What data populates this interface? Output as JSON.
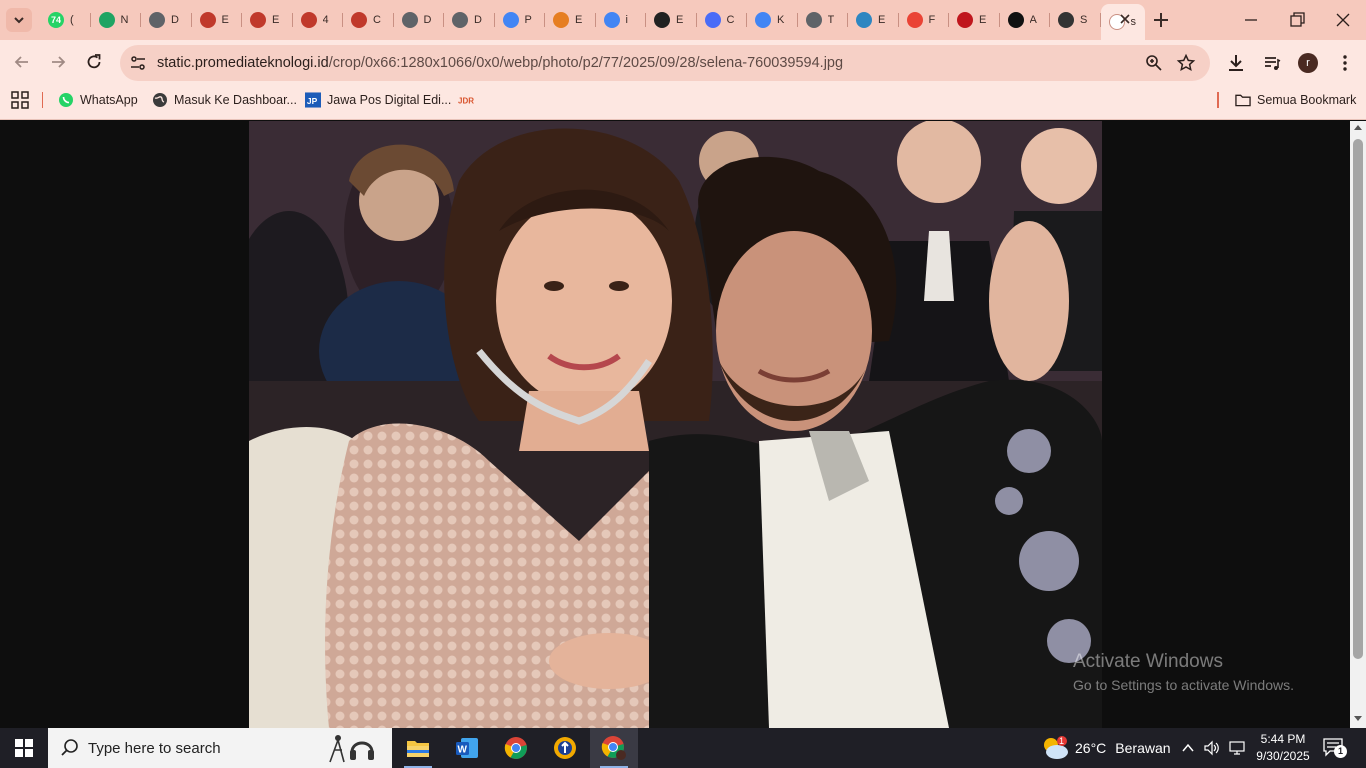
{
  "browser": {
    "tabs": [
      {
        "label": "(",
        "favicon": "whatsapp-icon",
        "color": "#25d366",
        "badge": "74"
      },
      {
        "label": "N",
        "favicon": "drive-icon",
        "color": "#1fa463"
      },
      {
        "label": "D",
        "favicon": "globe-icon",
        "color": "#5f6368"
      },
      {
        "label": "E",
        "favicon": "flame-icon",
        "color": "#c0392b"
      },
      {
        "label": "E",
        "favicon": "flame-icon",
        "color": "#c0392b"
      },
      {
        "label": "4",
        "favicon": "flame-icon",
        "color": "#c0392b"
      },
      {
        "label": "C",
        "favicon": "flame-icon",
        "color": "#c0392b"
      },
      {
        "label": "D",
        "favicon": "globe-icon",
        "color": "#5f6368"
      },
      {
        "label": "D",
        "favicon": "globe-icon",
        "color": "#5f6368"
      },
      {
        "label": "P",
        "favicon": "google-icon",
        "color": "#4285f4"
      },
      {
        "label": "E",
        "favicon": "puzzle-icon",
        "color": "#e67e22"
      },
      {
        "label": "i",
        "favicon": "google-icon",
        "color": "#4285f4"
      },
      {
        "label": "E",
        "favicon": "openai-icon",
        "color": "#222222"
      },
      {
        "label": "C",
        "favicon": "gemini-icon",
        "color": "#4a6cf7"
      },
      {
        "label": "K",
        "favicon": "google-icon",
        "color": "#4285f4"
      },
      {
        "label": "T",
        "favicon": "globe-icon",
        "color": "#5f6368"
      },
      {
        "label": "E",
        "favicon": "earth-icon",
        "color": "#2e86c1"
      },
      {
        "label": "F",
        "favicon": "gmail-icon",
        "color": "#ea4335"
      },
      {
        "label": "E",
        "favicon": "tribun-icon",
        "color": "#c0161d"
      },
      {
        "label": "A",
        "favicon": "infinity-icon",
        "color": "#111111"
      },
      {
        "label": "S",
        "favicon": "speaker-icon",
        "color": "#333333"
      },
      {
        "label": "s",
        "favicon": "blank-icon",
        "color": "#ffffff",
        "active": true
      }
    ],
    "url_host": "static.promediateknologi.id",
    "url_path": "/crop/0x66:1280x1066/0x0/webp/photo/p2/77/2025/09/28/selena-760039594.jpg",
    "profile_initial": "r"
  },
  "bookmarks": {
    "items": [
      {
        "label": "WhatsApp",
        "icon": "whatsapp-icon"
      },
      {
        "label": "Masuk Ke Dashboar...",
        "icon": "globe-icon"
      },
      {
        "label": "Jawa Pos Digital Edi...",
        "icon": "jawapos-icon"
      },
      {
        "label": "",
        "icon": "jdr-icon"
      }
    ],
    "all_bookmarks": "Semua Bookmark"
  },
  "watermark": {
    "line1": "Activate Windows",
    "line2": "Go to Settings to activate Windows."
  },
  "taskbar": {
    "search_placeholder": "Type here to search",
    "weather_temp": "26°C",
    "weather_text": "Berawan",
    "weather_badge": "1",
    "time": "5:44 PM",
    "date": "9/30/2025",
    "notification_count": "1"
  }
}
